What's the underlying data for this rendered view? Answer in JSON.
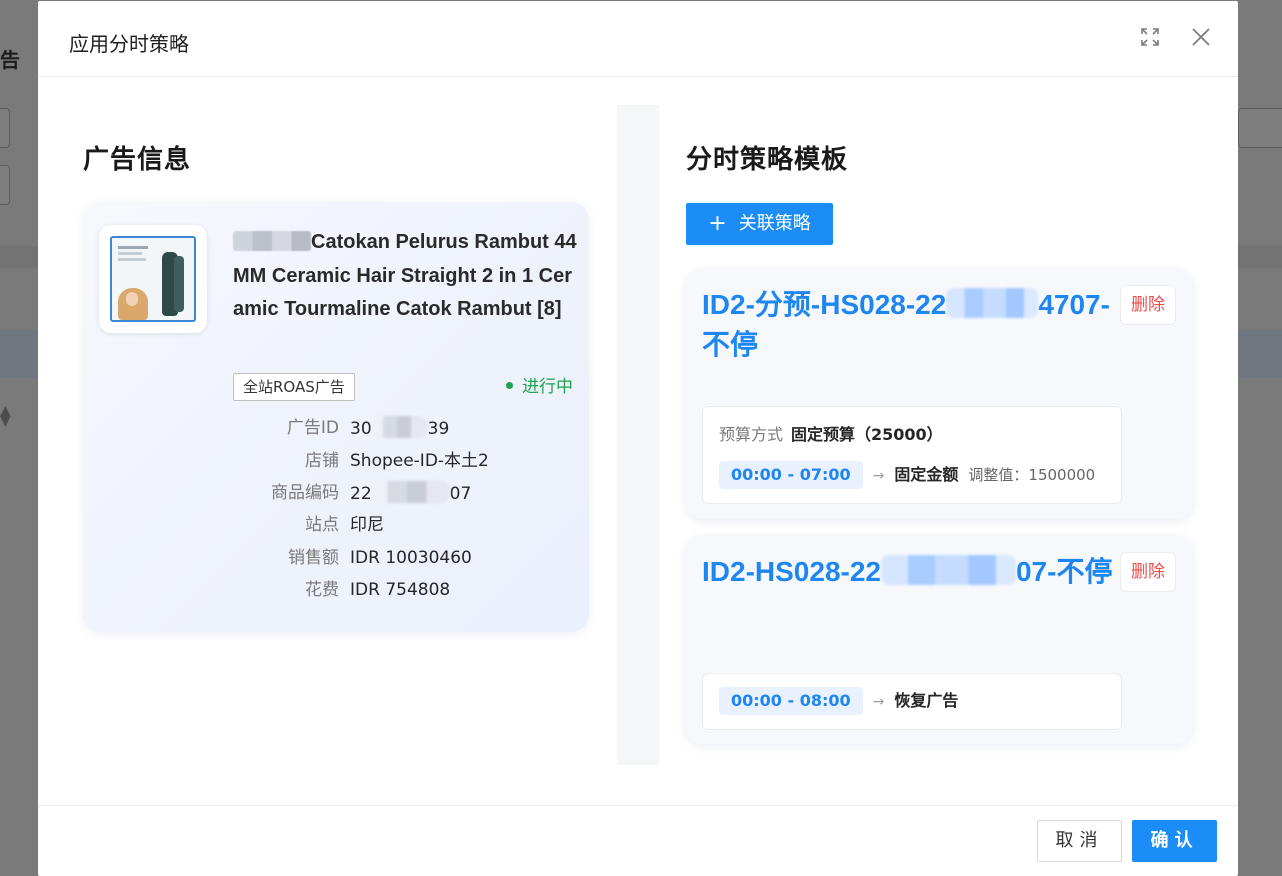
{
  "background": {
    "page_fragment_text": "告"
  },
  "modal": {
    "title": "应用分时策略",
    "fullscreen_icon": "fullscreen-icon",
    "close_icon": "close-icon"
  },
  "ad_info": {
    "section_title": "广告信息",
    "product_title": "Catokan Pelurus Rambut 44MM Ceramic Hair Straight 2 in 1 Ceramic Tourmaline Catok Rambut [8]",
    "tag": "全站ROAS广告",
    "status": "进行中",
    "status_color": "#21a253",
    "fields": [
      {
        "label": "广告ID",
        "value_prefix": "30",
        "value_suffix": "39"
      },
      {
        "label": "店铺",
        "value": "Shopee-ID-本土2"
      },
      {
        "label": "商品编码",
        "value_prefix": "22",
        "value_suffix": "07"
      },
      {
        "label": "站点",
        "value": "印尼"
      },
      {
        "label": "销售额",
        "value": "IDR 10030460"
      },
      {
        "label": "花费",
        "value": "IDR 754808"
      }
    ]
  },
  "strategy": {
    "section_title": "分时策略模板",
    "link_button": "关联策略",
    "link_button_icon": "plus-icon",
    "delete_label": "删除",
    "cards": [
      {
        "title_part1": "ID2-分预-HS028-22",
        "title_part2": "47",
        "title_part3": "07-不停",
        "budget_label": "预算方式",
        "budget_value": "固定预算（25000）",
        "time_range": "00:00 - 07:00",
        "action": "固定金额",
        "adjust_label": "调整值：",
        "adjust_value": "1500000"
      },
      {
        "title_part1": "ID2-HS028-22",
        "title_part2": "07-",
        "title_part3": "不停",
        "time_range": "00:00 - 08:00",
        "action": "恢复广告"
      }
    ]
  },
  "footer": {
    "cancel": "取消",
    "confirm": "确认"
  },
  "colors": {
    "primary": "#1c8cf7",
    "title_blue": "#1e86f0",
    "danger": "#ee4b4b",
    "success": "#21a253"
  }
}
